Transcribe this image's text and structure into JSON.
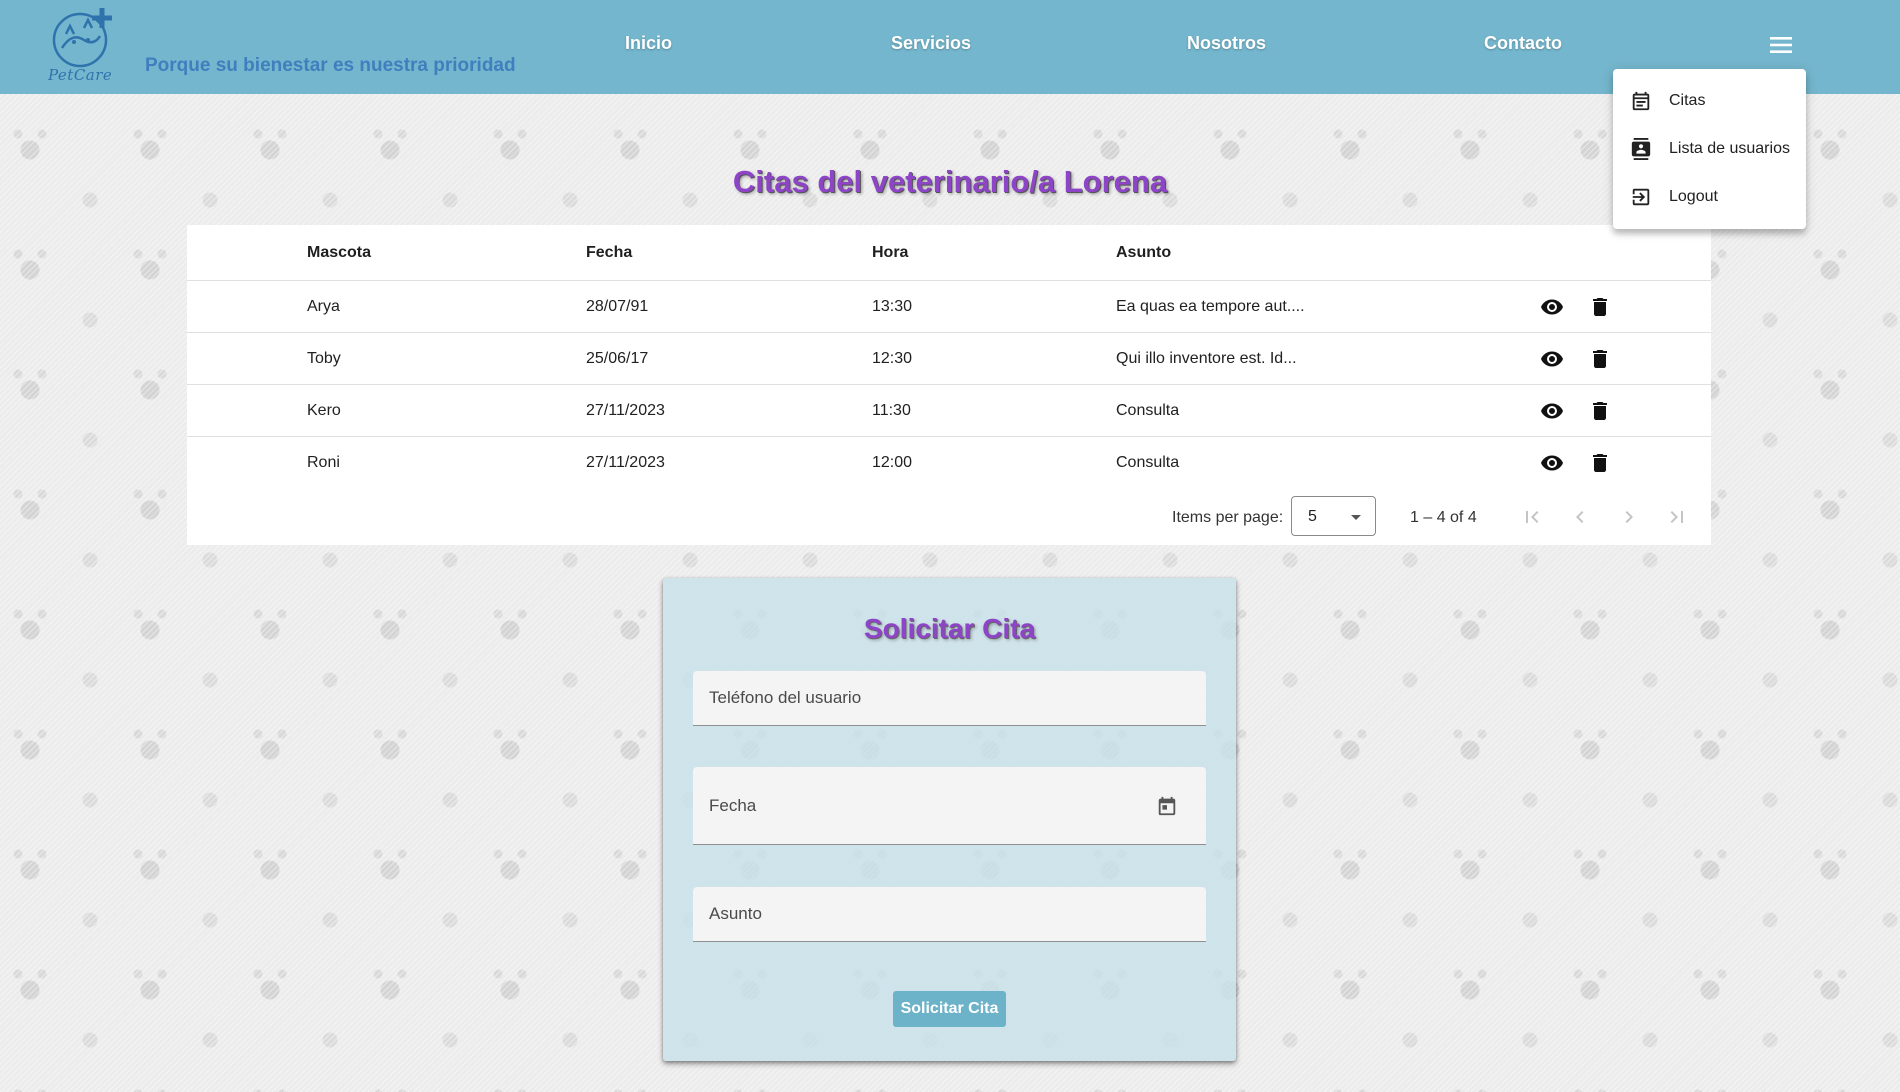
{
  "header": {
    "logo_text": "PetCare",
    "tagline": "Porque su bienestar es nuestra prioridad",
    "nav": [
      "Inicio",
      "Servicios",
      "Nosotros",
      "Contacto"
    ]
  },
  "menu": {
    "items": [
      {
        "label": "Citas",
        "icon": "calendar-icon"
      },
      {
        "label": "Lista de usuarios",
        "icon": "contacts-icon"
      },
      {
        "label": "Logout",
        "icon": "logout-icon"
      }
    ]
  },
  "page": {
    "title": "Citas del veterinario/a Lorena"
  },
  "table": {
    "headers": [
      "Mascota",
      "Fecha",
      "Hora",
      "Asunto"
    ],
    "rows": [
      {
        "mascota": "Arya",
        "fecha": "28/07/91",
        "hora": "13:30",
        "asunto": "Ea quas ea tempore aut...."
      },
      {
        "mascota": "Toby",
        "fecha": "25/06/17",
        "hora": "12:30",
        "asunto": "Qui illo inventore est. Id..."
      },
      {
        "mascota": "Kero",
        "fecha": "27/11/2023",
        "hora": "11:30",
        "asunto": "Consulta"
      },
      {
        "mascota": "Roni",
        "fecha": "27/11/2023",
        "hora": "12:00",
        "asunto": "Consulta"
      }
    ],
    "paginator": {
      "items_per_page_label": "Items per page:",
      "items_per_page": "5",
      "range": "1 – 4 of 4"
    }
  },
  "form": {
    "title": "Solicitar Cita",
    "telefono_label": "Teléfono del usuario",
    "fecha_label": "Fecha",
    "asunto_label": "Asunto",
    "submit": "Solicitar Cita"
  },
  "colors": {
    "navbar": "#74b6cd",
    "title_purple": "#8e44c7",
    "button": "#6cb3c9"
  }
}
